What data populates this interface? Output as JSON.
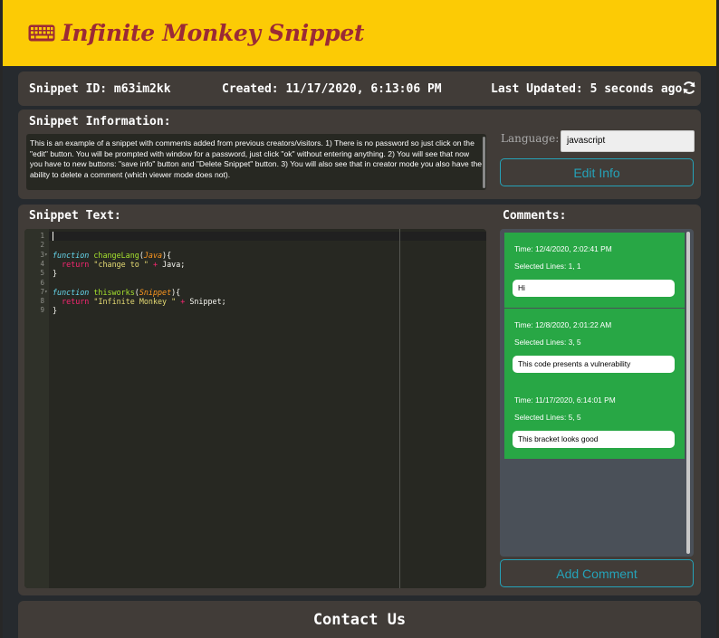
{
  "header": {
    "title": "Infinite Monkey Snippet",
    "icon": "keyboard-icon"
  },
  "info_bar": {
    "snippet_id": "Snippet ID: m63im2kk",
    "created": "Created: 11/17/2020, 6:13:06 PM",
    "last_updated": "Last Updated: 5 seconds ago",
    "refresh_icon": "refresh-icon"
  },
  "snippet_info": {
    "heading": "Snippet Information:",
    "description": "This is an example of a snippet with comments added from previous creators/visitors. 1) There is no password so just click on the \"edit\" button. You will be prompted with window for a password, just click \"ok\" without entering anything. 2) You will see that now you have to new buttons: \"save info\" button and \"Delete Snippet\" button. 3) You will also see that in creator mode you also have the ability to delete a comment (which viewer mode does not).",
    "language_label": "Language:",
    "language_value": "javascript",
    "edit_button": "Edit Info"
  },
  "snippet_text": {
    "heading": "Snippet Text:",
    "line_numbers": [
      "1",
      "2",
      "3",
      "4",
      "5",
      "6",
      "7",
      "8",
      "9"
    ],
    "code": {
      "l3_kw": "function",
      "l3_fn": "changeLang",
      "l3_open": "(",
      "l3_param": "Java",
      "l3_close": "){",
      "l4_ret": "return",
      "l4_str": "\"change to \"",
      "l4_op": "+",
      "l4_rest": "Java;",
      "l5": "}",
      "l7_kw": "function",
      "l7_fn": "thisworks",
      "l7_open": "(",
      "l7_param": "Snippet",
      "l7_close": "){",
      "l8_ret": "return",
      "l8_str": "\"Infinite Monkey \"",
      "l8_op": "+",
      "l8_rest": "Snippet;",
      "l9": "}"
    }
  },
  "comments": {
    "heading": "Comments:",
    "items": [
      {
        "time": "Time: 12/4/2020, 2:02:41 PM",
        "lines": "Selected Lines: 1, 1",
        "text": "Hi"
      },
      {
        "time": "Time: 12/8/2020, 2:01:22 AM",
        "lines": "Selected Lines: 3, 5",
        "text": "This code presents a vulnerability"
      },
      {
        "time": "Time: 11/17/2020, 6:14:01 PM",
        "lines": "Selected Lines: 5, 5",
        "text": "This bracket looks good"
      }
    ],
    "add_button": "Add Comment"
  },
  "footer": {
    "contact_title": "Contact Us"
  },
  "colors": {
    "header_bg": "#fccb05",
    "title_color": "#9b2a36",
    "panel_bg": "#413c38",
    "comment_card": "#28a745",
    "accent": "#25a2b8"
  }
}
